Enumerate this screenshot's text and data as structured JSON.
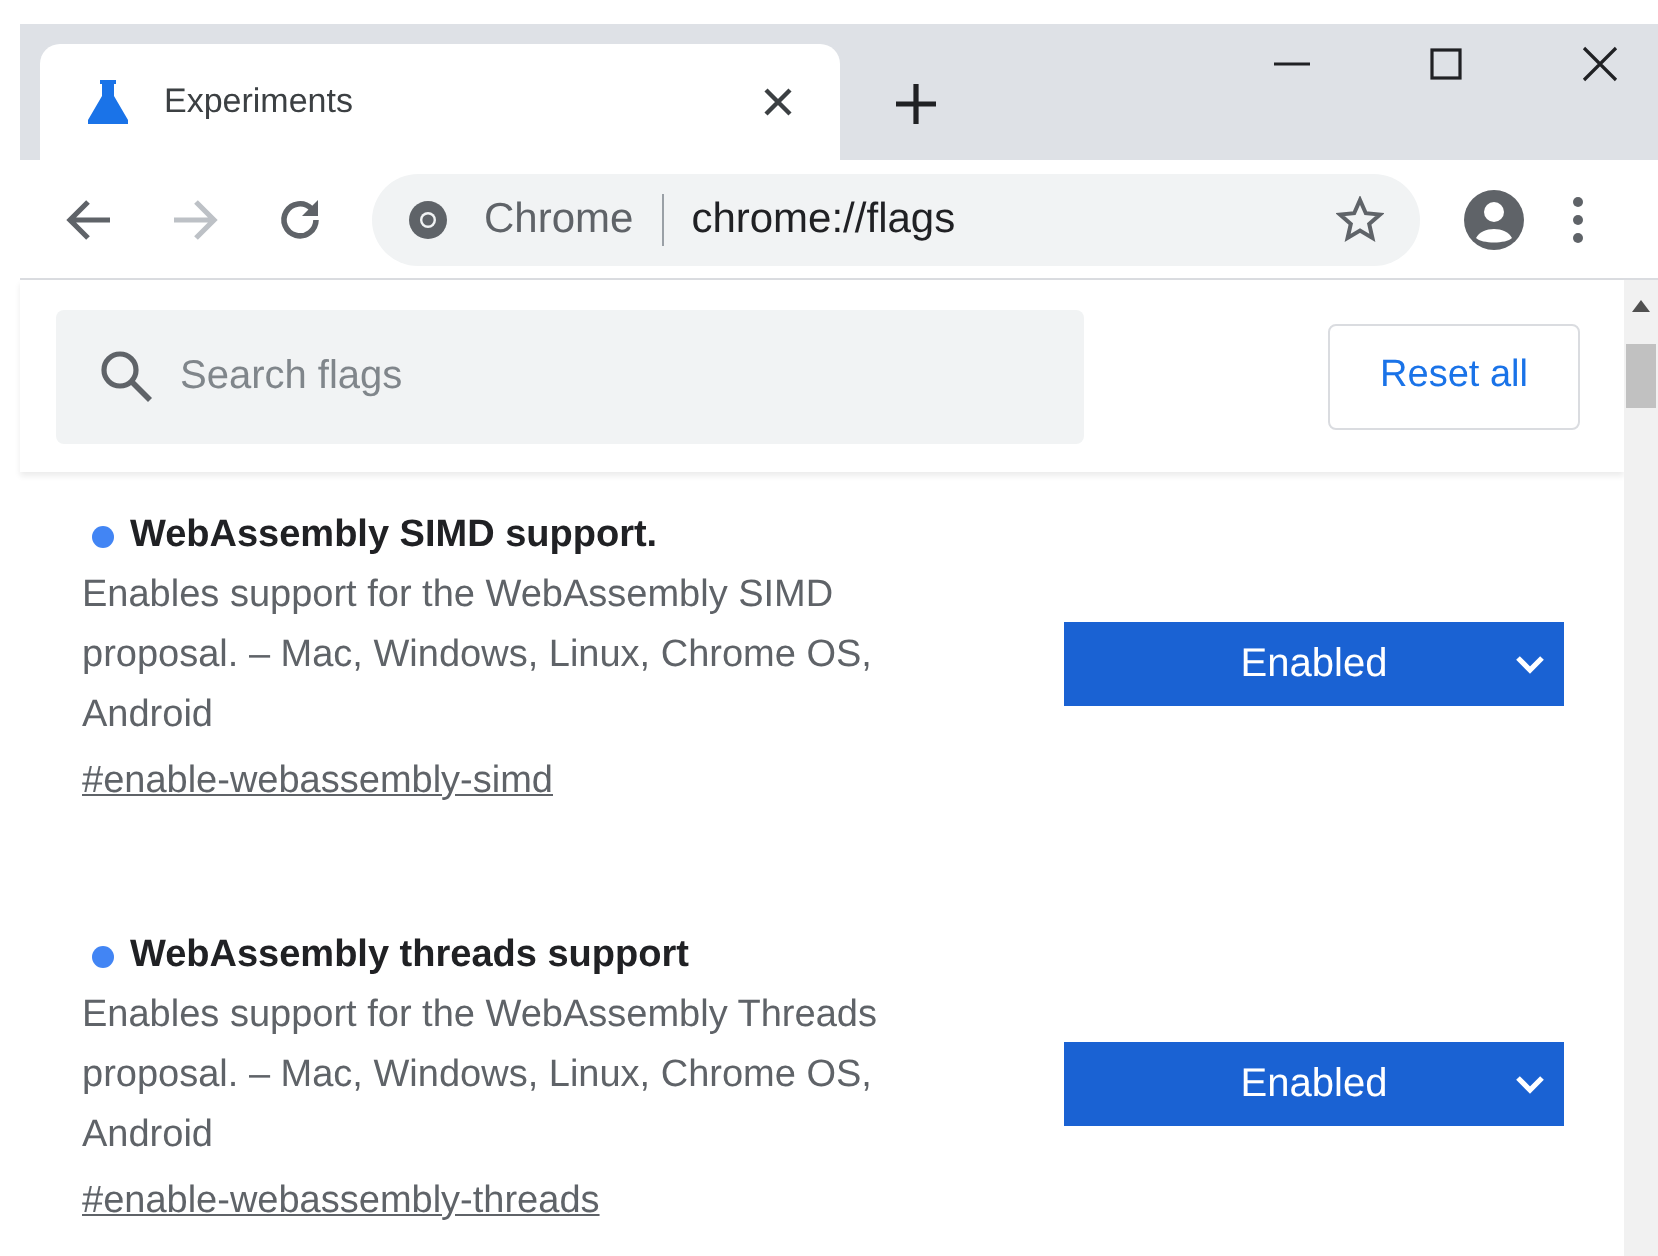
{
  "tab": {
    "title": "Experiments",
    "selected": true
  },
  "address_bar": {
    "site_label": "Chrome",
    "url": "chrome://flags"
  },
  "search": {
    "placeholder": "Search flags"
  },
  "reset_button": "Reset all",
  "flags": [
    {
      "title": "WebAssembly SIMD support.",
      "color": "#4285f4",
      "description": "Enables support for the WebAssembly SIMD proposal. – Mac, Windows, Linux, Chrome OS, Android",
      "link": "#enable-webassembly-simd",
      "value": "Enabled"
    },
    {
      "title": "WebAssembly threads support",
      "color": "#4285f4",
      "description": "Enables support for the WebAssembly Threads proposal. – Mac, Windows, Linux, Chrome OS, Android",
      "link": "#enable-webassembly-threads",
      "value": "Enabled"
    }
  ]
}
